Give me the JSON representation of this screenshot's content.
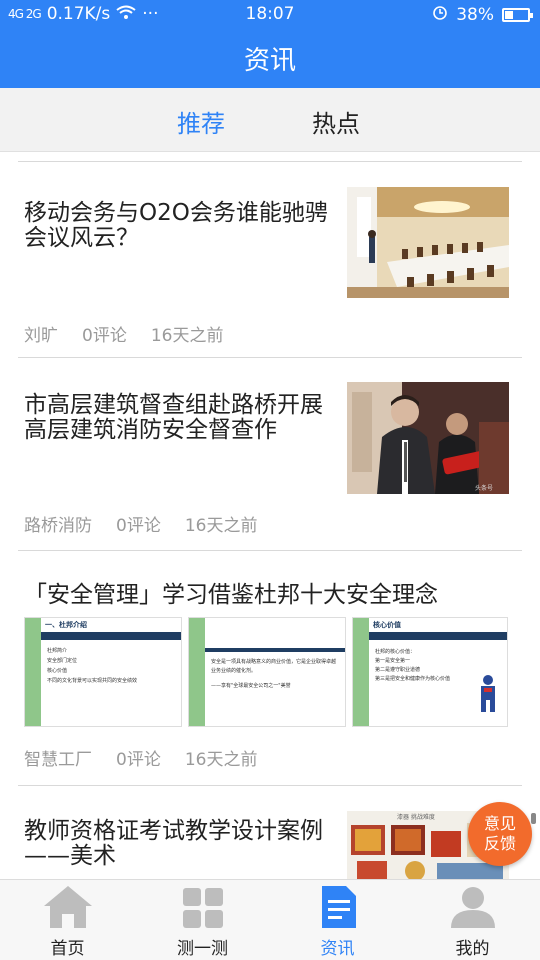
{
  "status_bar": {
    "signal": "4G 2G",
    "network_speed": "0.17K/s",
    "time": "18:07",
    "battery": "38%",
    "battery_level": 0.38
  },
  "header": {
    "title": "资讯"
  },
  "tabs": [
    {
      "label": "推荐",
      "active": true
    },
    {
      "label": "热点",
      "active": false
    }
  ],
  "articles": [
    {
      "title": "移动会务与O2O会务谁能驰骋会议风云？",
      "author": "刘旷",
      "comments": "0评论",
      "time": "16天之前"
    },
    {
      "title": "市高层建筑督查组赴路桥开展高层建筑消防安全督查作",
      "author": "路桥消防",
      "comments": "0评论",
      "time": "16天之前"
    },
    {
      "title": "「安全管理」学习借鉴杜邦十大安全理念",
      "author": "智慧工厂",
      "comments": "0评论",
      "time": "16天之前",
      "slides": [
        {
          "heading": "一、杜邦介绍",
          "lines": [
            "杜邦简介",
            "安全部门定位",
            "核心价值",
            "不同的文化背景可以实现共同的安全绩效"
          ]
        },
        {
          "heading": "",
          "lines": [
            "安全是一项具有战略意义的商业价值，它是企业取得卓越业务业绩的催化剂。",
            "——享有\"全球最安全公司之一\"美誉"
          ]
        },
        {
          "heading": "核心价值",
          "lines": [
            "杜邦的核心价值：",
            "第一是安全第一",
            "第二是遵守职业道德",
            "第三是把安全和健康作为核心价值"
          ]
        }
      ]
    },
    {
      "title": "教师资格证考试教学设计案例——美术"
    }
  ],
  "feedback_button": {
    "line1": "意见",
    "line2": "反馈"
  },
  "bottom_nav": [
    {
      "label": "首页",
      "icon": "home-icon",
      "active": false
    },
    {
      "label": "测一测",
      "icon": "grid-icon",
      "active": false
    },
    {
      "label": "资讯",
      "icon": "news-icon",
      "active": true
    },
    {
      "label": "我的",
      "icon": "user-icon",
      "active": false
    }
  ],
  "colors": {
    "primary": "#2f83f6",
    "feedback": "#f26b2c",
    "meta_text": "#9a9a9a",
    "inactive_icon": "#bdbdbd"
  }
}
